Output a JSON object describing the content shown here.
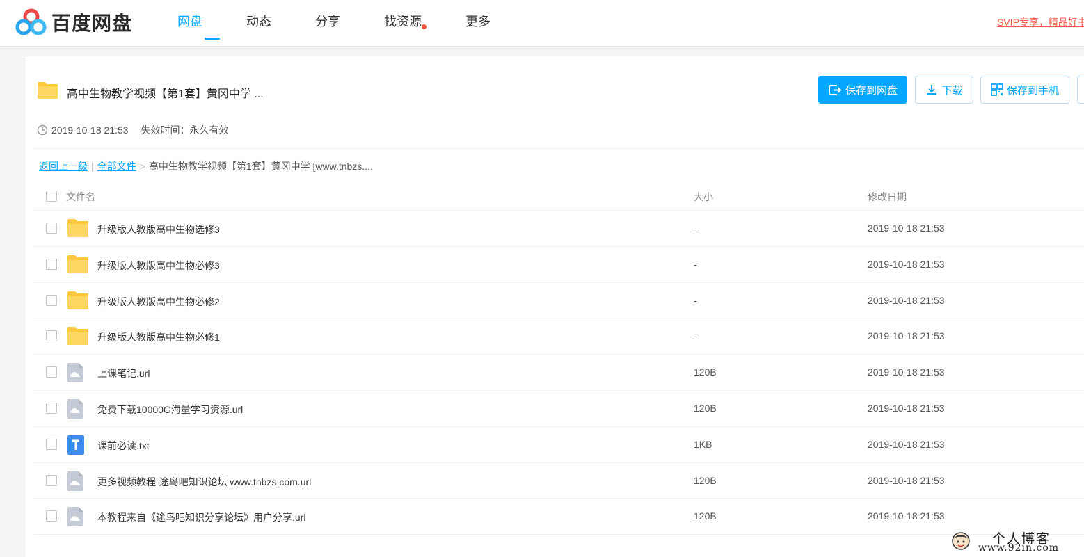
{
  "header": {
    "logo_text": "百度网盘",
    "nav": [
      {
        "label": "网盘",
        "active": true
      },
      {
        "label": "动态",
        "active": false
      },
      {
        "label": "分享",
        "active": false
      },
      {
        "label": "找资源",
        "active": false,
        "badge_dot": true
      },
      {
        "label": "更多",
        "active": false
      }
    ],
    "svip_link": "SVIP专享，精品好书"
  },
  "share": {
    "title": "高中生物教学视频【第1套】黄冈中学 ...",
    "created": "2019-10-18 21:53",
    "expire_label": "失效时间：永久有效",
    "buttons": {
      "save": "保存到网盘",
      "download": "下载",
      "save_phone": "保存到手机"
    }
  },
  "breadcrumb": {
    "back": "返回上一级",
    "sep": "|",
    "all_files": "全部文件",
    "arrow": ">",
    "current": "高中生物教学视频【第1套】黄冈中学 [www.tnbzs...."
  },
  "table": {
    "headers": {
      "name": "文件名",
      "size": "大小",
      "date": "修改日期"
    },
    "rows": [
      {
        "name": "升级版人教版高中生物选修3",
        "size": "-",
        "date": "2019-10-18 21:53",
        "type": "folder"
      },
      {
        "name": "升级版人教版高中生物必修3",
        "size": "-",
        "date": "2019-10-18 21:53",
        "type": "folder"
      },
      {
        "name": "升级版人教版高中生物必修2",
        "size": "-",
        "date": "2019-10-18 21:53",
        "type": "folder"
      },
      {
        "name": "升级版人教版高中生物必修1",
        "size": "-",
        "date": "2019-10-18 21:53",
        "type": "folder"
      },
      {
        "name": "上课笔记.url",
        "size": "120B",
        "date": "2019-10-18 21:53",
        "type": "url"
      },
      {
        "name": "免费下载10000G海量学习资源.url",
        "size": "120B",
        "date": "2019-10-18 21:53",
        "type": "url"
      },
      {
        "name": "课前必读.txt",
        "size": "1KB",
        "date": "2019-10-18 21:53",
        "type": "txt"
      },
      {
        "name": "更多视频教程-途鸟吧知识论坛 www.tnbzs.com.url",
        "size": "120B",
        "date": "2019-10-18 21:53",
        "type": "url"
      },
      {
        "name": "本教程来自《途鸟吧知识分享论坛》用户分享.url",
        "size": "120B",
        "date": "2019-10-18 21:53",
        "type": "url"
      }
    ]
  },
  "watermark": {
    "line1": "个人博客",
    "line2": "www.92in.com"
  },
  "colors": {
    "accent": "#06a7ff",
    "svip": "#f55a4e",
    "folder": "#ffc83d",
    "txt": "#3c8cf0",
    "url": "#c5cbd6"
  }
}
